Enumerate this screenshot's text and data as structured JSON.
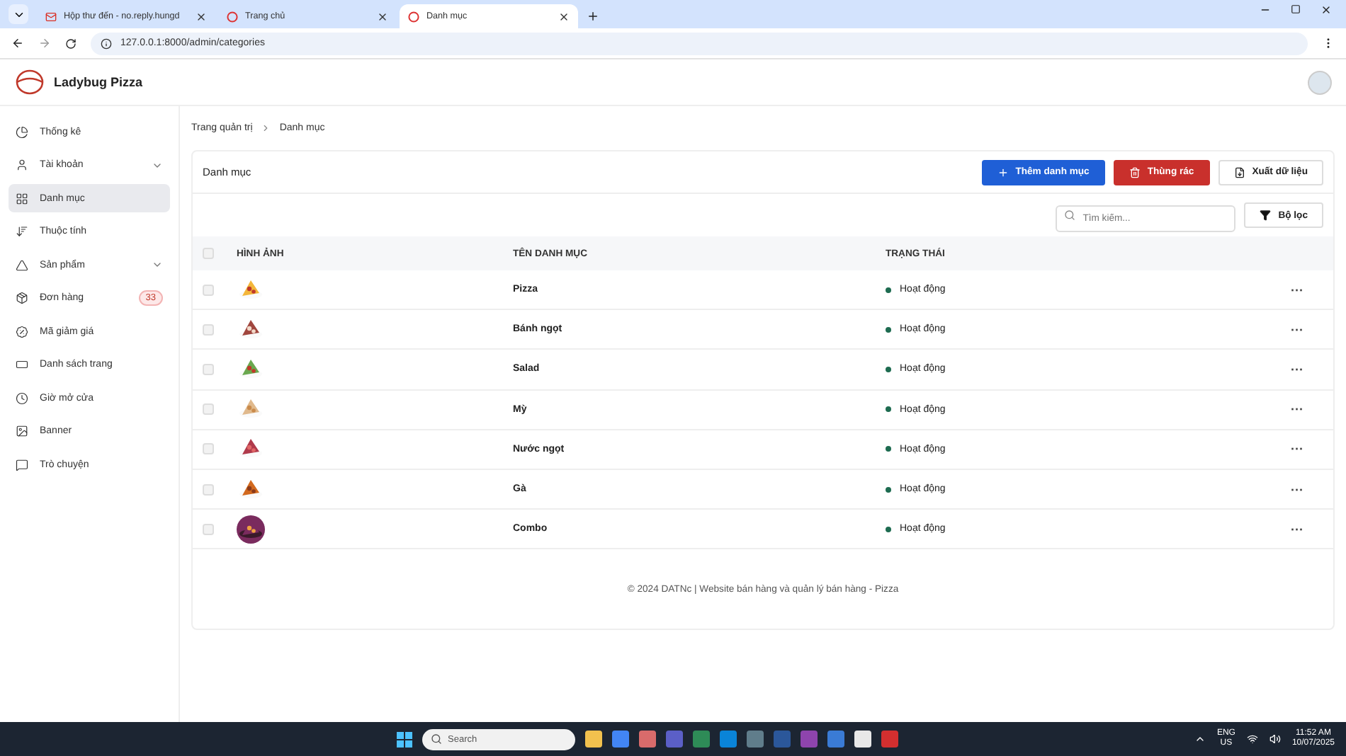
{
  "browser": {
    "tabs": [
      {
        "title": "Hộp thư đến - no.reply.hungd",
        "kind": "mail",
        "selected": false
      },
      {
        "title": "Trang chủ",
        "kind": "site",
        "selected": false
      },
      {
        "title": "Danh mục",
        "kind": "site",
        "selected": true
      }
    ],
    "url": "127.0.0.1:8000/admin/categories"
  },
  "app": {
    "brand": "Ladybug Pizza"
  },
  "sidebar": {
    "items": [
      {
        "label": "Thống kê",
        "kind": "link",
        "selected": false
      },
      {
        "label": "Tài khoản",
        "kind": "group",
        "selected": false
      },
      {
        "label": "Danh mục",
        "kind": "link",
        "selected": true
      },
      {
        "label": "Thuộc tính",
        "kind": "link",
        "selected": false
      },
      {
        "label": "Sản phẩm",
        "kind": "group",
        "selected": false
      },
      {
        "label": "Đơn hàng",
        "kind": "link",
        "selected": false,
        "badge": "33"
      },
      {
        "label": "Mã giảm giá",
        "kind": "link",
        "selected": false
      },
      {
        "label": "Danh sách trang",
        "kind": "link",
        "selected": false
      },
      {
        "label": "Giờ mở cửa",
        "kind": "link",
        "selected": false
      },
      {
        "label": "Banner",
        "kind": "link",
        "selected": false
      },
      {
        "label": "Trò chuyện",
        "kind": "link",
        "selected": false
      }
    ]
  },
  "breadcrumb": [
    "Trang quản trị",
    "Danh mục"
  ],
  "card": {
    "title": "Danh mục",
    "buttons": [
      {
        "label": "Thêm danh mục",
        "kind": "primary"
      },
      {
        "label": "Thùng rác",
        "kind": "danger"
      },
      {
        "label": "Xuất dữ liệu",
        "kind": "outline"
      }
    ],
    "search": {
      "placeholder": "Tìm kiếm..."
    },
    "filter_button": "Bộ lọc"
  },
  "table": {
    "all_checked": false,
    "columns": [
      "HÌNH ẢNH",
      "TÊN DANH MỤC",
      "TRẠNG THÁI"
    ],
    "rows": [
      {
        "name": "Pizza",
        "status": "Hoạt động",
        "color": "#1d6b50",
        "checked": false,
        "actions": "···"
      },
      {
        "name": "Bánh ngọt",
        "status": "Hoạt động",
        "color": "#1d6b50",
        "checked": false,
        "actions": "···"
      },
      {
        "name": "Salad",
        "status": "Hoạt động",
        "color": "#1d6b50",
        "checked": false,
        "actions": "···"
      },
      {
        "name": "Mỳ",
        "status": "Hoạt động",
        "color": "#1d6b50",
        "checked": false,
        "actions": "···"
      },
      {
        "name": "Nước ngọt",
        "status": "Hoạt động",
        "color": "#1d6b50",
        "checked": false,
        "actions": "···"
      },
      {
        "name": "Gà",
        "status": "Hoạt động",
        "color": "#1d6b50",
        "checked": false,
        "actions": "···"
      },
      {
        "name": "Combo",
        "status": "Hoạt động",
        "color": "#1d6b50",
        "checked": false,
        "actions": "···"
      }
    ]
  },
  "footer": "© 2024 DATNc | Website bán hàng và quản lý bán hàng - Pizza",
  "taskbar": {
    "search_placeholder": "Search",
    "language": "ENG",
    "region": "US",
    "time": "11:52 AM",
    "date": "10/07/2025"
  }
}
